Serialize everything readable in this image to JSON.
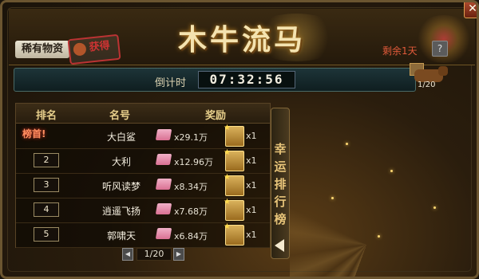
{
  "header": {
    "badge_rare": "稀有物资",
    "stamp_text": "获得",
    "title": "木牛流马",
    "remaining": "剩余1天",
    "help_label": "?"
  },
  "countdown": {
    "label": "倒计时",
    "time": "07:32:56"
  },
  "ox": {
    "count": "1/20"
  },
  "table": {
    "headers": [
      "排名",
      "名号",
      "奖励"
    ],
    "rows": [
      {
        "rank": "榜首!",
        "name": "大白鲨",
        "book_value": "x29.1万",
        "card_value": "x1"
      },
      {
        "rank": "2",
        "name": "大利",
        "book_value": "x12.96万",
        "card_value": "x1"
      },
      {
        "rank": "3",
        "name": "听风读梦",
        "book_value": "x8.34万",
        "card_value": "x1"
      },
      {
        "rank": "4",
        "name": "逍遥飞扬",
        "book_value": "x7.68万",
        "card_value": "x1"
      },
      {
        "rank": "5",
        "name": "郭啸天",
        "book_value": "x6.84万",
        "card_value": "x1"
      }
    ]
  },
  "pager": {
    "text": "1/20",
    "prev_label": "◀",
    "next_label": "▶"
  },
  "side_tab": {
    "label": "幸运排行榜"
  },
  "icons": {
    "book": "skill-book-icon",
    "card": "reward-card-icon",
    "ox": "wooden-ox-icon",
    "close": "close-icon",
    "help": "help-icon",
    "arrow": "collapse-arrow-icon"
  },
  "colors": {
    "accent_gold": "#e7cf8b",
    "title": "#f4e3b0",
    "remaining": "#e15a3a"
  }
}
